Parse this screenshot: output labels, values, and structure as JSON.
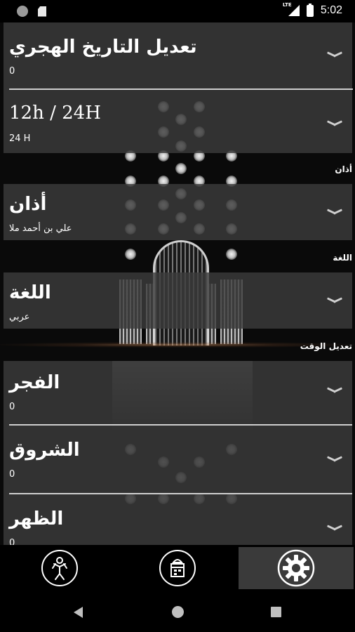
{
  "status_bar": {
    "time": "5:02",
    "network_label": "LTE",
    "icons": [
      "notification-dot-icon",
      "sd-card-icon",
      "lte-signal-icon",
      "battery-icon"
    ]
  },
  "settings": {
    "hijri": {
      "title": "تعديل التاريخ الهجري",
      "value": "0"
    },
    "time_format": {
      "title": "12h / 24H",
      "value": "24 H"
    },
    "adhan_section": "أذان",
    "adhan": {
      "title": "أذان",
      "value": "علي بن أحمد ملا"
    },
    "language_section": "اللغة",
    "language": {
      "title": "اللغة",
      "value": "عربي"
    },
    "time_adjust_section": "تعديل الوقت",
    "fajr": {
      "title": "الفجر",
      "value": "0"
    },
    "shuruq": {
      "title": "الشروق",
      "value": "0"
    },
    "dhuhr": {
      "title": "الظهر",
      "value": "0"
    }
  },
  "bottom_nav": {
    "items": [
      {
        "name": "prayer",
        "icon": "praying-person-icon",
        "active": false
      },
      {
        "name": "calendar",
        "icon": "mosque-calendar-icon",
        "active": false
      },
      {
        "name": "settings",
        "icon": "gear-icon",
        "active": true
      }
    ]
  },
  "system_nav": [
    "back-icon",
    "home-icon",
    "recents-icon"
  ]
}
